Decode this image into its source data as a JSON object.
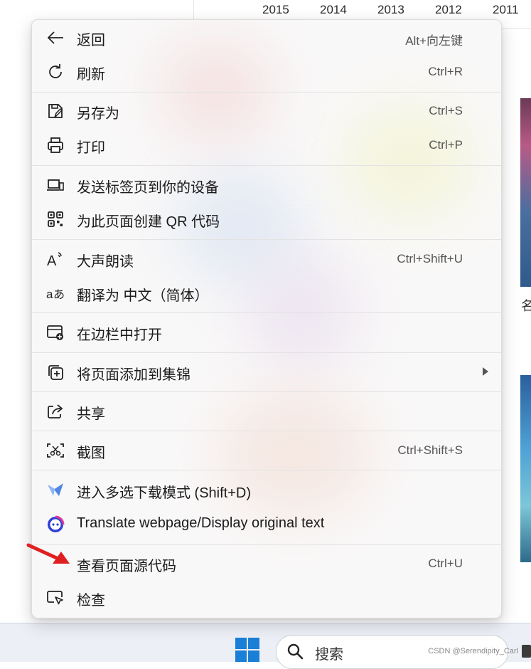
{
  "background": {
    "years": [
      "2015",
      "2014",
      "2013",
      "2012",
      "2011"
    ],
    "thumb_caption": "名"
  },
  "menu": {
    "items": [
      {
        "label": "返回",
        "shortcut": "Alt+向左键",
        "icon": "back-arrow-icon"
      },
      {
        "label": "刷新",
        "shortcut": "Ctrl+R",
        "icon": "refresh-icon"
      },
      {
        "label": "另存为",
        "shortcut": "Ctrl+S",
        "icon": "save-as-icon"
      },
      {
        "label": "打印",
        "shortcut": "Ctrl+P",
        "icon": "printer-icon"
      },
      {
        "label": "发送标签页到你的设备",
        "shortcut": "",
        "icon": "devices-icon"
      },
      {
        "label": "为此页面创建 QR 代码",
        "shortcut": "",
        "icon": "qr-code-icon"
      },
      {
        "label": "大声朗读",
        "shortcut": "Ctrl+Shift+U",
        "icon": "read-aloud-icon"
      },
      {
        "label": "翻译为 中文（简体）",
        "shortcut": "",
        "icon": "translate-icon"
      },
      {
        "label": "在边栏中打开",
        "shortcut": "",
        "icon": "sidebar-open-icon"
      },
      {
        "label": "将页面添加到集锦",
        "shortcut": "",
        "icon": "collections-add-icon",
        "has_submenu": true
      },
      {
        "label": "共享",
        "shortcut": "",
        "icon": "share-icon"
      },
      {
        "label": "截图",
        "shortcut": "Ctrl+Shift+S",
        "icon": "screenshot-icon"
      },
      {
        "label": "进入多选下载模式 (Shift+D)",
        "shortcut": "",
        "icon": "multi-download-icon"
      },
      {
        "label": "Translate webpage/Display original text",
        "shortcut": "",
        "icon": "translator-extension-icon"
      },
      {
        "label": "查看页面源代码",
        "shortcut": "Ctrl+U",
        "icon": "view-source-icon"
      },
      {
        "label": "检查",
        "shortcut": "",
        "icon": "inspect-icon"
      }
    ]
  },
  "taskbar": {
    "search_label": "搜索",
    "watermark": "CSDN @Serendipity_Carl"
  },
  "colors": {
    "menu_bg": "#f9f8f8",
    "windows_blue": "#1a7fd6",
    "annotation_arrow": "#e02020"
  }
}
